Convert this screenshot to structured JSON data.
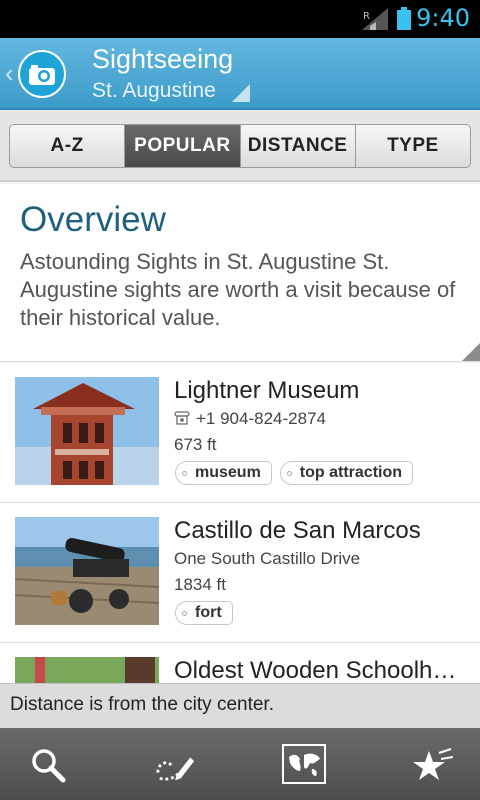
{
  "status": {
    "time": "9:40",
    "signal_icon": "signal-roaming-icon",
    "battery_icon": "battery-icon"
  },
  "header": {
    "title": "Sightseeing",
    "subtitle": "St. Augustine",
    "back_icon": "back-chevron-icon",
    "logo_icon": "camera-icon",
    "accent_color": "#3d9bc9"
  },
  "tabs": [
    {
      "label": "A-Z",
      "active": false
    },
    {
      "label": "POPULAR",
      "active": true
    },
    {
      "label": "DISTANCE",
      "active": false
    },
    {
      "label": "TYPE",
      "active": false
    }
  ],
  "overview": {
    "title": "Overview",
    "text": "Astounding Sights in St. Augustine    St. Augustine sights are worth a visit because of their historical value."
  },
  "items": [
    {
      "name": "Lightner Museum",
      "line1": "+1 904-824-2874",
      "line1_icon": "phone-icon",
      "line2": "673 ft",
      "tags": [
        "museum",
        "top attraction"
      ]
    },
    {
      "name": "Castillo de San Marcos",
      "line1": "One South Castillo Drive",
      "line2": "1834 ft",
      "tags": [
        "fort"
      ]
    },
    {
      "name": "Oldest Wooden Schoolh…"
    }
  ],
  "info": {
    "text": "Distance is from the city center."
  },
  "toolbar": {
    "icons": [
      "search-icon",
      "route-pencil-icon",
      "world-map-icon",
      "favorites-star-icon"
    ]
  }
}
